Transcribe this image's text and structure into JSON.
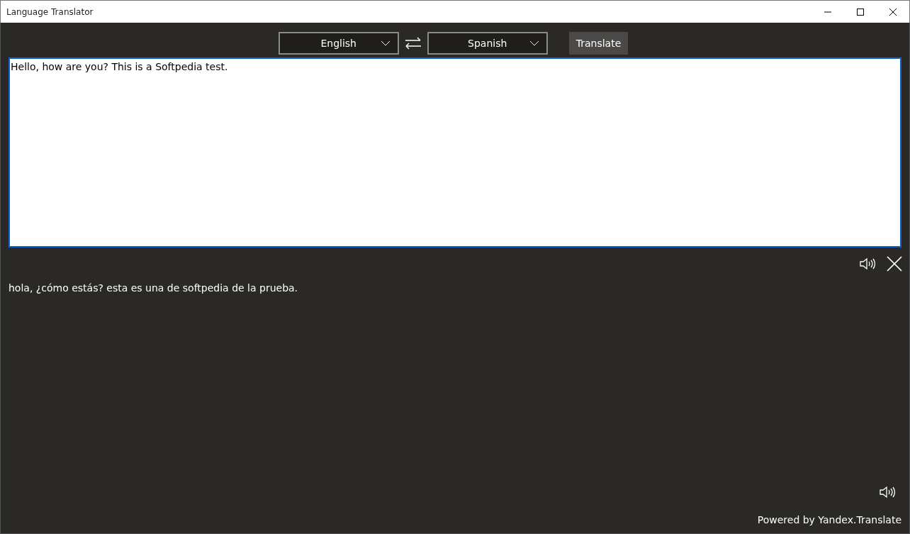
{
  "window": {
    "title": "Language Translator"
  },
  "source_language": {
    "value": "English"
  },
  "target_language": {
    "value": "Spanish"
  },
  "translate_button": {
    "label": "Translate"
  },
  "input": {
    "value": "Hello, how are you? This is a Softpedia test."
  },
  "output": {
    "text": "hola, ¿cómo estás? esta es una de softpedia de la prueba."
  },
  "footer": {
    "text": "Powered by Yandex.Translate"
  }
}
